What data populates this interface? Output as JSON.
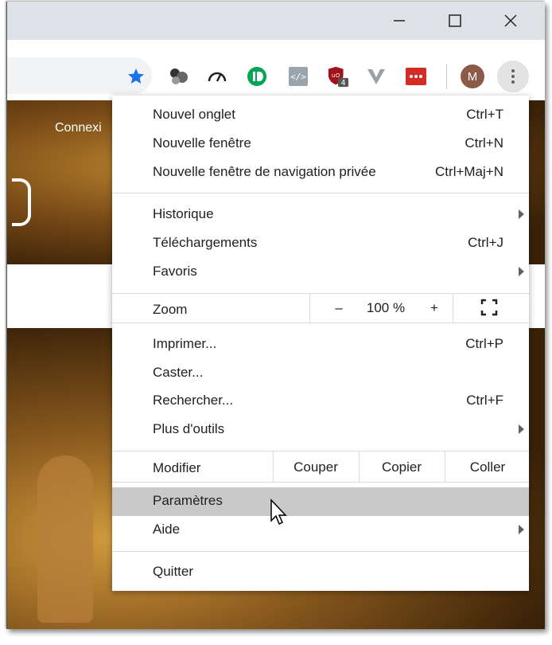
{
  "extensions": {
    "ublock_badge": "4"
  },
  "avatar_initial": "M",
  "page": {
    "connexion_label": "Connexi"
  },
  "menu": {
    "group1": [
      {
        "label": "Nouvel onglet",
        "shortcut": "Ctrl+T"
      },
      {
        "label": "Nouvelle fenêtre",
        "shortcut": "Ctrl+N"
      },
      {
        "label": "Nouvelle fenêtre de navigation privée",
        "shortcut": "Ctrl+Maj+N"
      }
    ],
    "group2": [
      {
        "label": "Historique",
        "submenu": true
      },
      {
        "label": "Téléchargements",
        "shortcut": "Ctrl+J"
      },
      {
        "label": "Favoris",
        "submenu": true
      }
    ],
    "zoom": {
      "label": "Zoom",
      "minus": "–",
      "value": "100 %",
      "plus": "+"
    },
    "group3": [
      {
        "label": "Imprimer...",
        "shortcut": "Ctrl+P"
      },
      {
        "label": "Caster..."
      },
      {
        "label": "Rechercher...",
        "shortcut": "Ctrl+F"
      },
      {
        "label": "Plus d'outils",
        "submenu": true
      }
    ],
    "edit": {
      "label": "Modifier",
      "cut": "Couper",
      "copy": "Copier",
      "paste": "Coller"
    },
    "group4": [
      {
        "label": "Paramètres",
        "highlighted": true
      },
      {
        "label": "Aide",
        "submenu": true
      }
    ],
    "quit": {
      "label": "Quitter"
    }
  },
  "colors": {
    "star": "#1a73e8",
    "highlight": "#c9c9c9",
    "ublock": "#a1121b",
    "lastpass": "#d32d27",
    "onedrive_green": "#00a651"
  }
}
